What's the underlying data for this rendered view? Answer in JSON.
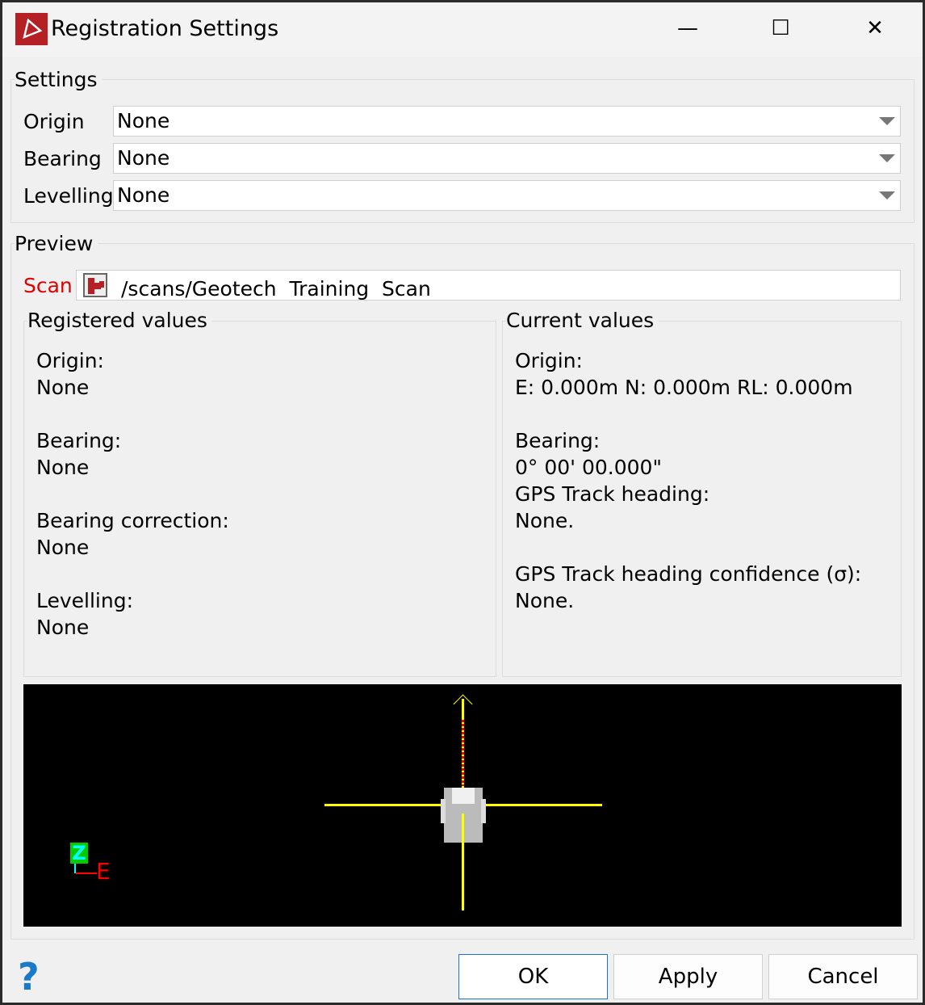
{
  "window": {
    "title": "Registration Settings",
    "minimize": "—",
    "maximize": "☐",
    "close": "✕"
  },
  "settings": {
    "group_label": "Settings",
    "rows": [
      {
        "label": "Origin",
        "value": "None"
      },
      {
        "label": "Bearing",
        "value": "None"
      },
      {
        "label": "Levelling",
        "value": "None"
      }
    ]
  },
  "preview": {
    "group_label": "Preview",
    "scan_label": "Scan",
    "scan_path": "/scans/Geotech  Training  Scan",
    "registered": {
      "label": "Registered values",
      "text": "Origin:\nNone\n\nBearing:\nNone\n\nBearing correction:\nNone\n\nLevelling:\nNone"
    },
    "current": {
      "label": "Current values",
      "text": "Origin:\nE: 0.000m N: 0.000m RL: 0.000m\n\nBearing:\n0° 00' 00.000\"\nGPS Track heading:\nNone.\n\nGPS Track heading confidence (σ):\nNone."
    },
    "axis": {
      "z": "Z",
      "e": "E"
    }
  },
  "buttons": {
    "help": "?",
    "ok": "OK",
    "apply": "Apply",
    "cancel": "Cancel"
  },
  "colors": {
    "accent": "#b52025",
    "scan_label": "#e00000",
    "crosshair": "#ffff00"
  }
}
